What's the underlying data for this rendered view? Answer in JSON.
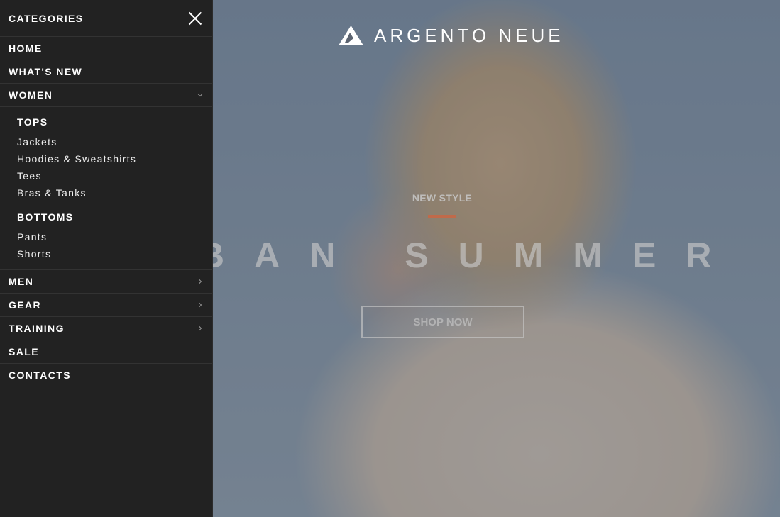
{
  "sidebar": {
    "title": "CATEGORIES",
    "items_top": [
      {
        "label": "HOME"
      },
      {
        "label": "WHAT'S NEW"
      }
    ],
    "women": {
      "label": "WOMEN",
      "expanded": true
    },
    "women_submenu": {
      "tops": {
        "title": "TOPS",
        "links": [
          "Jackets",
          "Hoodies & Sweatshirts",
          "Tees",
          "Bras & Tanks"
        ]
      },
      "bottoms": {
        "title": "BOTTOMS",
        "links": [
          "Pants",
          "Shorts"
        ]
      }
    },
    "items_bottom": [
      {
        "label": "MEN",
        "icon": "chevron-right-icon"
      },
      {
        "label": "GEAR",
        "icon": "chevron-right-icon"
      },
      {
        "label": "TRAINING",
        "icon": "chevron-right-icon"
      },
      {
        "label": "SALE"
      },
      {
        "label": "CONTACTS"
      }
    ]
  },
  "hero": {
    "brand": "ARGENTO NEUE",
    "kicker": "NEW STYLE",
    "headline": "BAN SUMMER",
    "cta": "SHOP NOW",
    "accent_color": "#c06a4a"
  },
  "colors": {
    "sidebar_bg": "#222222",
    "text": "#ffffff"
  }
}
